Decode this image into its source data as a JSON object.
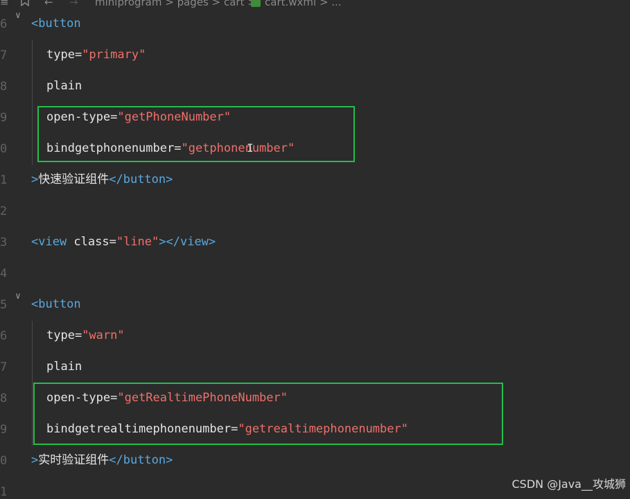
{
  "breadcrumb": {
    "menu_icon": "≡",
    "bookmark_icon": "bookmark-icon",
    "back_icon": "←",
    "forward_icon": "→",
    "path": "miniprogram > pages > cart >",
    "file": "cart.wxml > ..."
  },
  "line_numbers": [
    "6",
    "7",
    "8",
    "9",
    "0",
    "1",
    "2",
    "3",
    "4",
    "5",
    "6",
    "7",
    "8",
    "9",
    "0",
    "1"
  ],
  "code": {
    "l1": {
      "open": "<button"
    },
    "l2": {
      "attr": "type=",
      "val": "\"primary\""
    },
    "l3": {
      "attr": "plain"
    },
    "l4": {
      "attr": "open-type=",
      "val": "\"getPhoneNumber\""
    },
    "l5": {
      "attr": "bindgetphonenumber=",
      "val": "\"getphonenumber\""
    },
    "l6": {
      "gt": ">",
      "text": "快速验证组件",
      "close": "</button>"
    },
    "l8": {
      "open": "<view ",
      "attr": "class=",
      "val": "\"line\"",
      "close": "></view>"
    },
    "l10": {
      "open": "<button"
    },
    "l11": {
      "attr": "type=",
      "val": "\"warn\""
    },
    "l12": {
      "attr": "plain"
    },
    "l13": {
      "attr": "open-type=",
      "val": "\"getRealtimePhoneNumber\""
    },
    "l14": {
      "attr": "bindgetrealtimephonenumber=",
      "val": "\"getrealtimephonenumber\""
    },
    "l15": {
      "gt": ">",
      "text": "实时验证组件",
      "close": "</button>"
    }
  },
  "colors": {
    "tag": "#59a9e0",
    "value": "#f0706a",
    "highlight": "#22c04a"
  },
  "watermark": "CSDN @Java__攻城狮"
}
